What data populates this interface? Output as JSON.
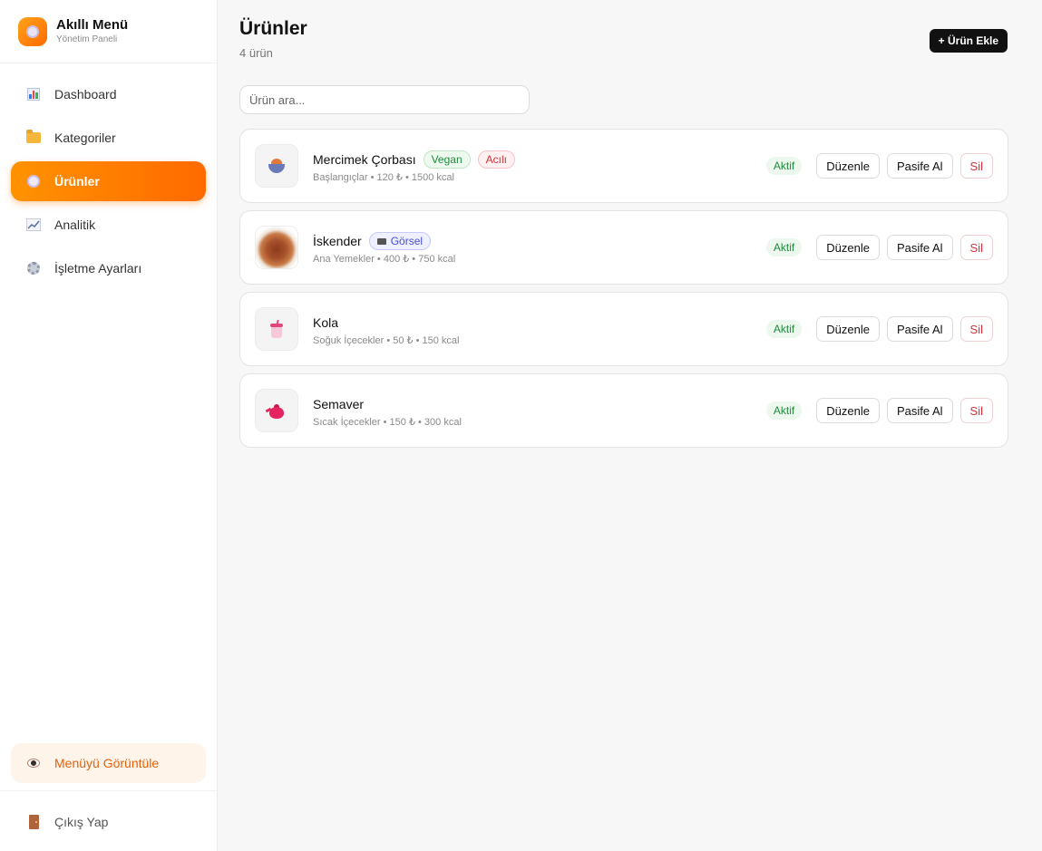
{
  "app": {
    "name": "Akıllı Menü",
    "subtitle": "Yönetim Paneli"
  },
  "sidebar": {
    "items": [
      {
        "label": "Dashboard",
        "icon": "bar-chart-icon"
      },
      {
        "label": "Kategoriler",
        "icon": "folder-icon"
      },
      {
        "label": "Ürünler",
        "icon": "plate-icon",
        "active": true
      },
      {
        "label": "Analitik",
        "icon": "line-chart-icon"
      },
      {
        "label": "İşletme Ayarları",
        "icon": "gear-icon"
      }
    ],
    "view_menu": "Menüyü Görüntüle",
    "logout": "Çıkış Yap"
  },
  "header": {
    "title": "Ürünler",
    "count": "4 ürün",
    "add_button": "+ Ürün Ekle"
  },
  "search": {
    "placeholder": "Ürün ara..."
  },
  "products": [
    {
      "name": "Mercimek Çorbası",
      "tags": [
        "Vegan",
        "Acılı"
      ],
      "meta": "Başlangıçlar • 120 ₺ • 1500 kcal",
      "status": "Aktif",
      "icon": "soup-icon"
    },
    {
      "name": "İskender",
      "tags": [
        "Görsel"
      ],
      "meta": "Ana Yemekler • 400 ₺ • 750 kcal",
      "status": "Aktif",
      "icon": "photo"
    },
    {
      "name": "Kola",
      "tags": [],
      "meta": "Soğuk İçecekler • 50 ₺ • 150 kcal",
      "status": "Aktif",
      "icon": "cup-icon"
    },
    {
      "name": "Semaver",
      "tags": [],
      "meta": "Sıcak İçecekler • 150 ₺ • 300 kcal",
      "status": "Aktif",
      "icon": "teapot-icon"
    }
  ],
  "actions": {
    "edit": "Düzenle",
    "deactivate": "Pasife Al",
    "delete": "Sil"
  },
  "colors": {
    "accent": "#ff7a00",
    "active_status": "#1f8b3b",
    "delete": "#d0313b"
  }
}
